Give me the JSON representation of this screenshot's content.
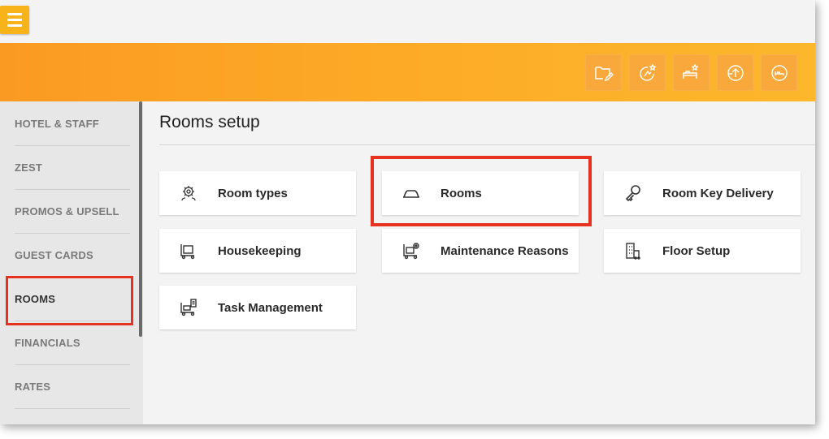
{
  "header": {
    "menu_icon": "hamburger-icon",
    "toolbar": [
      {
        "name": "folder-edit-icon"
      },
      {
        "name": "rate-star-icon"
      },
      {
        "name": "room-star-icon"
      },
      {
        "name": "upload-icon"
      },
      {
        "name": "room-service-icon"
      }
    ]
  },
  "sidebar": {
    "items": [
      {
        "label": "HOTEL & STAFF"
      },
      {
        "label": "ZEST"
      },
      {
        "label": "PROMOS & UPSELL"
      },
      {
        "label": "GUEST CARDS"
      },
      {
        "label": "ROOMS",
        "active": true
      },
      {
        "label": "FINANCIALS"
      },
      {
        "label": "RATES"
      }
    ]
  },
  "main": {
    "title": "Rooms setup",
    "cards": [
      {
        "label": "Room types",
        "icon": "gear-people-icon"
      },
      {
        "label": "Rooms",
        "icon": "arch-icon"
      },
      {
        "label": "Room Key Delivery",
        "icon": "key-icon"
      },
      {
        "label": "Housekeeping",
        "icon": "cart-icon"
      },
      {
        "label": "Maintenance Reasons",
        "icon": "maintenance-cart-icon"
      },
      {
        "label": "Floor Setup",
        "icon": "building-icon"
      },
      {
        "label": "Task Management",
        "icon": "task-cart-icon"
      }
    ]
  },
  "colors": {
    "accent": "#f8b21a",
    "highlight": "#e6321e"
  }
}
